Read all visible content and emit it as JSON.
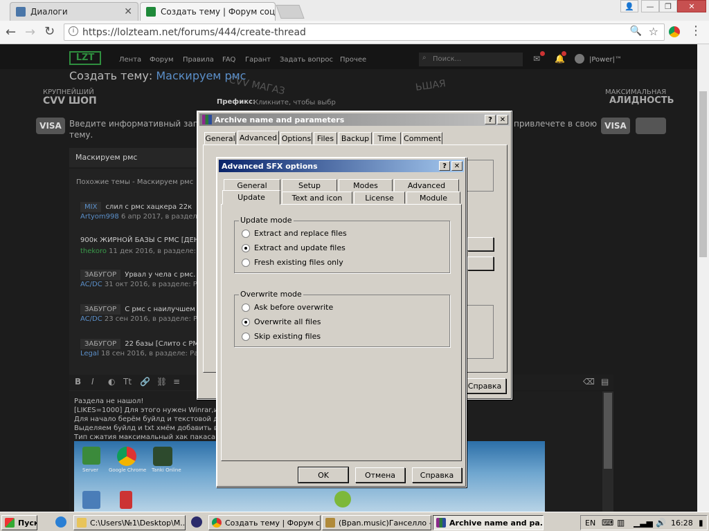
{
  "browser": {
    "tabs": [
      {
        "title": "Диалоги"
      },
      {
        "title": "Создать тему | Форум соц"
      }
    ],
    "url": "https://lolzteam.net/forums/444/create-thread"
  },
  "site": {
    "logo": "LZT",
    "nav": [
      "Лента",
      "Форум",
      "Правила",
      "FAQ",
      "Гарант",
      "Задать вопрос",
      "Прочее"
    ],
    "search_placeholder": "Поиск...",
    "username": "|Power|™",
    "page_title_prefix": "Создать тему:",
    "page_title_name": "Маскируем рмс",
    "banner_left_1": "КРУПНЕЙШИЙ",
    "banner_left_2": "CVV ШОП",
    "banner_right_1": "МАКСИМАЛЬНАЯ",
    "banner_right_2": "АЛИДНОСТЬ",
    "banner_center": "CVV МАГАЗ",
    "banner_center_2": "ЬШАЯ",
    "prefix_label": "Префикс:",
    "prefix_value": "Кликните, чтобы выбр",
    "info_text_left": "Введите информативный заго",
    "info_text_left_2": "тему.",
    "info_text_right": "привлечете в свою",
    "title_value": "Маскируем рмс",
    "similar_label": "Похожие темы - Маскируем рмс",
    "similar": [
      {
        "tag": "MIX",
        "title": "слил с рмс хацкера 22к",
        "author": "Artyom998",
        "meta": "6 апр 2017, в разделе: Разд"
      },
      {
        "tag": "",
        "title": "900к ЖИРНОЙ БАЗЫ С РМС [ДЕН",
        "author": "thekoro",
        "meta": "11 дек 2016, в разделе: Разда"
      },
      {
        "tag": "ЗАБУГОР",
        "title": "Урвал у чела с рмс.",
        "author": "AC/DC",
        "meta": "31 окт 2016, в разделе: Разда»"
      },
      {
        "tag": "ЗАБУГОР",
        "title": "С рмс с наилучшем с",
        "author": "AC/DC",
        "meta": "23 сен 2016, в разделе: Разда»и"
      },
      {
        "tag": "ЗАБУГОР",
        "title": "22 базы [Слито с РМС",
        "author": "Legal",
        "meta": "18 сен 2016, в разделе: Разда»и Ф"
      }
    ],
    "editor_lines": [
      "Раздела не нашол!",
      "[LIKES=1000] Для этого нужен Winrar,икон",
      "Для начало берём буйлд и текстовой доку",
      "Выделяем буйлд и txt хмём добавить в ар",
      "Тип сжатия максимальный хак пакасано"
    ],
    "desktop_icons": [
      "Server",
      "Google Chrome",
      "Tanki Online"
    ]
  },
  "archive_dialog": {
    "title": "Archive name and parameters",
    "tabs": [
      "General",
      "Advanced",
      "Options",
      "Files",
      "Backup",
      "Time",
      "Comment"
    ],
    "active_tab": "Advanced",
    "help_button": "Справка"
  },
  "sfx_dialog": {
    "title": "Advanced SFX options",
    "tabs_row1": [
      "General",
      "Setup",
      "Modes",
      "Advanced"
    ],
    "tabs_row2": [
      "Update",
      "Text and icon",
      "License",
      "Module"
    ],
    "active_tab": "Update",
    "update_mode": {
      "label": "Update mode",
      "options": [
        "Extract and replace files",
        "Extract and update files",
        "Fresh existing files only"
      ],
      "selected": 1
    },
    "overwrite_mode": {
      "label": "Overwrite mode",
      "options": [
        "Ask before overwrite",
        "Overwrite all files",
        "Skip existing files"
      ],
      "selected": 1
    },
    "buttons": {
      "ok": "OK",
      "cancel": "Отмена",
      "help": "Справка"
    }
  },
  "taskbar": {
    "start": "Пуск",
    "items": [
      "C:\\Users\\№1\\Desktop\\M...",
      "Создать тему | Форум с...",
      "(Враn.music)Ганселло –...",
      "Archive name and pa..."
    ],
    "lang": "EN",
    "time": "16:28"
  },
  "colors": {
    "title_active": "#0a246a",
    "title_inactive": "#808080",
    "accent_blue": "#5b8fc9",
    "win_face": "#d4d0c8"
  }
}
